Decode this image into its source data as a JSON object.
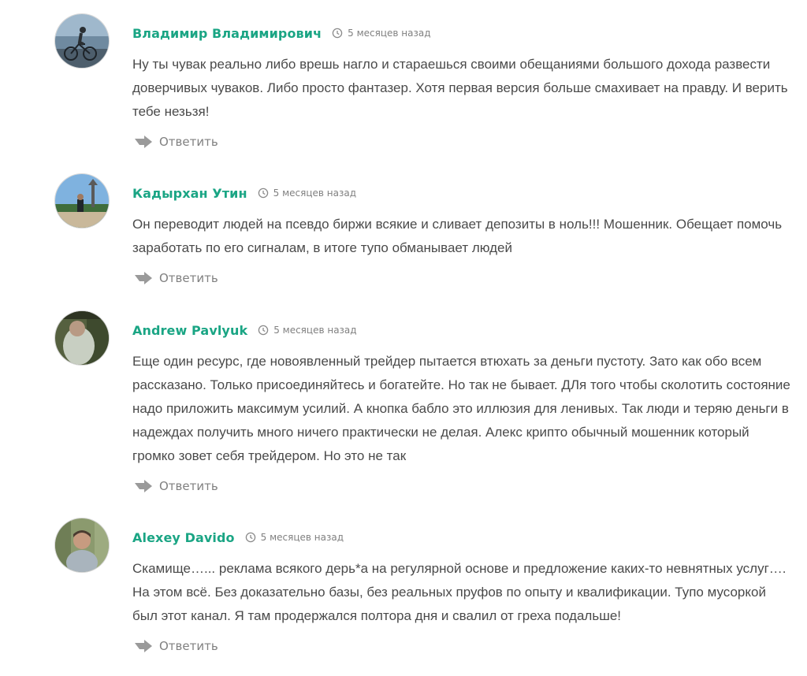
{
  "comments": [
    {
      "author": "Владимир Владимирович",
      "time": "5 месяцев назад",
      "text": "Ну ты чувак реально либо врешь нагло и стараешься своими обещаниями большого дохода развести доверчивых чуваков. Либо просто фантазер. Хотя первая версия больше смахивает на правду. И верить тебе незьзя!",
      "reply": "Ответить"
    },
    {
      "author": "Кадырхан Утин",
      "time": "5 месяцев назад",
      "text": "Он переводит людей на псевдо биржи всякие и сливает депозиты в ноль!!! Мошенник. Обещает помочь заработать по его сигналам, в итоге тупо обманывает людей",
      "reply": "Ответить"
    },
    {
      "author": "Andrew Pavlyuk",
      "time": "5 месяцев назад",
      "text": "Еще один ресурс, где новоявленный трейдер пытается втюхать за деньги пустоту. Зато как обо всем рассказано. Только присоединяйтесь и богатейте. Но так не бывает. ДЛя того чтобы сколотить состояние надо приложить максимум усилий. А кнопка бабло это иллюзия для ленивых. Так люди и теряю деньги в надеждах получить много ничего практически не делая. Алекс крипто обычный мошенник который громко зовет себя трейдером. Но это не так",
      "reply": "Ответить"
    },
    {
      "author": "Alexey Davido",
      "time": "5 месяцев назад",
      "text": "Скамище…... реклама всякого дерь*а на регулярной основе и предложение каких-то невнятных услуг…. На этом всё. Без доказательно базы, без реальных пруфов по опыту и квалификации. Тупо мусоркой был этот канал. Я там продержался полтора дня и свалил от греха подальше!",
      "reply": "Ответить"
    }
  ],
  "colors": {
    "author": "#1aa584",
    "text": "#4a4a4a",
    "meta": "#808080"
  },
  "icons": {
    "time": "clock-icon",
    "reply": "reply-arrow-icon"
  }
}
